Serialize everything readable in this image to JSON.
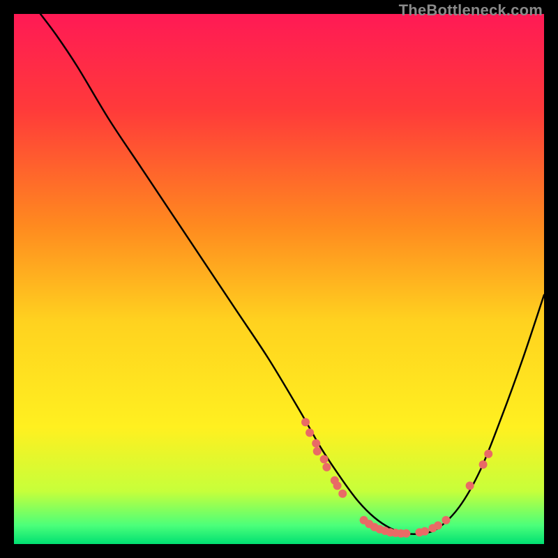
{
  "watermark": "TheBottleneck.com",
  "chart_data": {
    "type": "line",
    "title": "",
    "xlabel": "",
    "ylabel": "",
    "xlim": [
      0,
      100
    ],
    "ylim": [
      0,
      100
    ],
    "gradient": {
      "stops": [
        {
          "offset": 0.0,
          "color": "#ff1a55"
        },
        {
          "offset": 0.18,
          "color": "#ff3a3a"
        },
        {
          "offset": 0.4,
          "color": "#ff8a1f"
        },
        {
          "offset": 0.58,
          "color": "#ffd21f"
        },
        {
          "offset": 0.78,
          "color": "#fff020"
        },
        {
          "offset": 0.9,
          "color": "#c7ff3a"
        },
        {
          "offset": 0.965,
          "color": "#4bff7a"
        },
        {
          "offset": 1.0,
          "color": "#00e072"
        }
      ]
    },
    "series": [
      {
        "name": "curve",
        "stroke": "#000000",
        "strokeWidth": 2.5,
        "x": [
          5,
          8,
          12,
          18,
          24,
          30,
          36,
          42,
          48,
          54,
          58,
          62,
          65,
          68,
          71,
          74,
          77,
          80,
          84,
          88,
          92,
          96,
          100
        ],
        "y": [
          100,
          96,
          90,
          80,
          71,
          62,
          53,
          44,
          35,
          25,
          18,
          12,
          8,
          5,
          3,
          2,
          2,
          3,
          7,
          14,
          24,
          35,
          47
        ]
      }
    ],
    "marker_groups": [
      {
        "name": "left-cluster",
        "color": "#e96a66",
        "r": 6,
        "points": [
          {
            "x": 55,
            "y": 23
          },
          {
            "x": 55.8,
            "y": 21
          },
          {
            "x": 57,
            "y": 19
          },
          {
            "x": 57.2,
            "y": 17.5
          },
          {
            "x": 58.5,
            "y": 16
          },
          {
            "x": 59,
            "y": 14.5
          },
          {
            "x": 60.5,
            "y": 12
          },
          {
            "x": 61,
            "y": 11
          },
          {
            "x": 62,
            "y": 9.5
          }
        ]
      },
      {
        "name": "bottom-cluster",
        "color": "#e96a66",
        "r": 6,
        "points": [
          {
            "x": 66,
            "y": 4.5
          },
          {
            "x": 67,
            "y": 3.8
          },
          {
            "x": 68,
            "y": 3.2
          },
          {
            "x": 69,
            "y": 2.8
          },
          {
            "x": 70,
            "y": 2.5
          },
          {
            "x": 71,
            "y": 2.2
          },
          {
            "x": 72,
            "y": 2.1
          },
          {
            "x": 73,
            "y": 2
          },
          {
            "x": 74,
            "y": 2
          },
          {
            "x": 76.5,
            "y": 2.2
          },
          {
            "x": 77.5,
            "y": 2.4
          },
          {
            "x": 79,
            "y": 3
          },
          {
            "x": 80,
            "y": 3.5
          },
          {
            "x": 81.5,
            "y": 4.5
          }
        ]
      },
      {
        "name": "right-stray",
        "color": "#e96a66",
        "r": 6,
        "points": [
          {
            "x": 86,
            "y": 11
          },
          {
            "x": 88.5,
            "y": 15
          },
          {
            "x": 89.5,
            "y": 17
          }
        ]
      }
    ]
  }
}
